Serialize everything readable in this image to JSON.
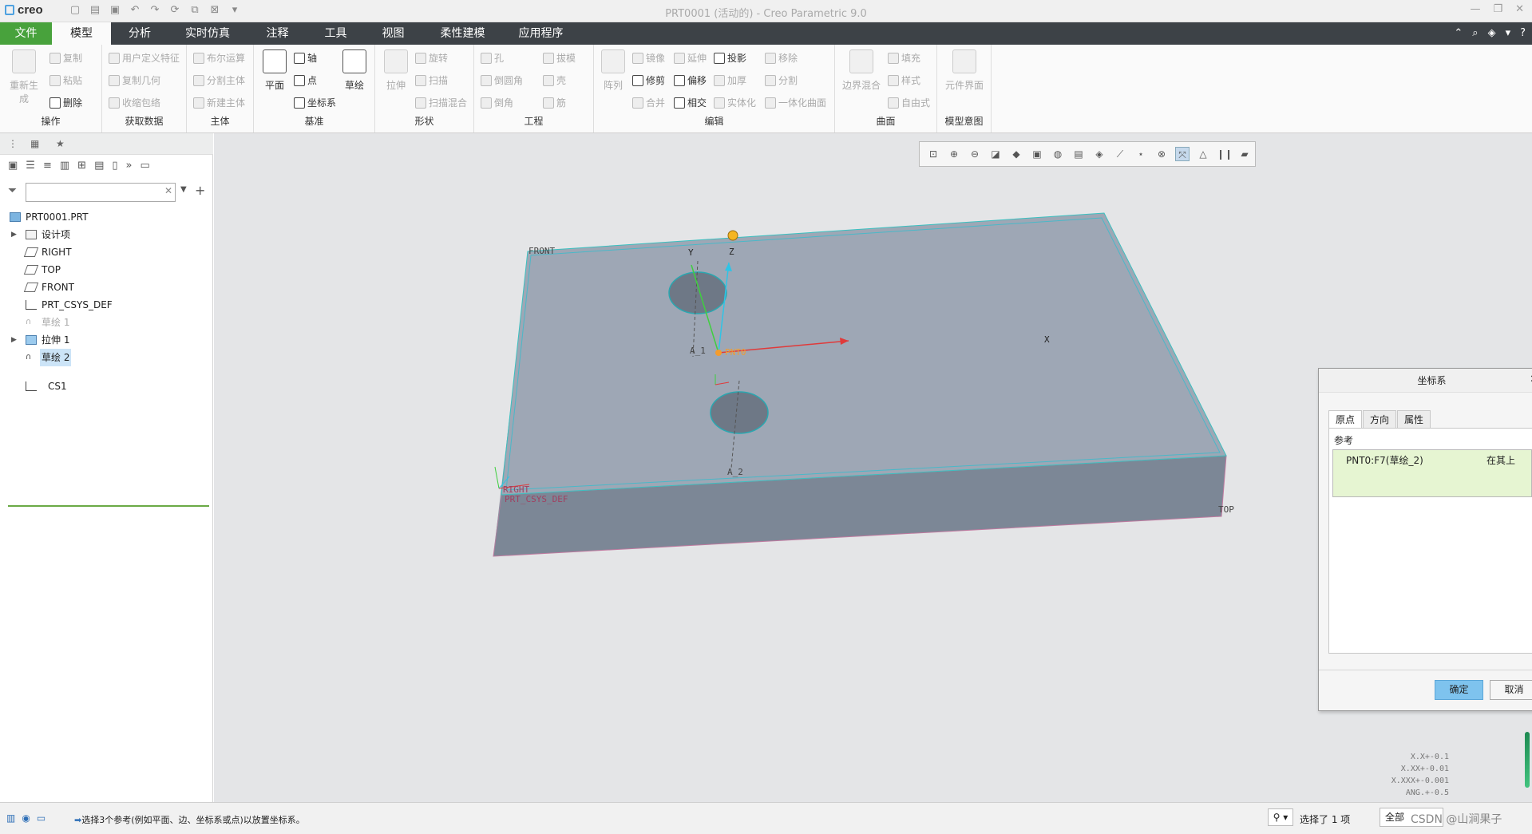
{
  "app": {
    "brand": "creo",
    "window_title": "PRT0001 (活动的) - Creo Parametric 9.0"
  },
  "colors": {
    "file_tab": "#48a23c",
    "menu_bg": "#3d4247",
    "part_face": "#9ea7b5",
    "part_side": "#7f8a98",
    "selection_green": "#e6f5d2",
    "ok_button": "#7ec3ee"
  },
  "menu": {
    "tabs": [
      "文件",
      "模型",
      "分析",
      "实时仿真",
      "注释",
      "工具",
      "视图",
      "柔性建模",
      "应用程序"
    ],
    "active": "模型"
  },
  "ribbon": {
    "groups": {
      "operations": {
        "label": "操作",
        "regenerate": "重新生成",
        "copy": "复制",
        "paste": "粘贴",
        "delete": "删除"
      },
      "get_data": {
        "label": "获取数据",
        "udf": "用户定义特征",
        "copy_geom": "复制几何",
        "shrinkwrap": "收缩包络"
      },
      "body": {
        "label": "主体",
        "boolean": "布尔运算",
        "split_body": "分割主体",
        "new_body": "新建主体"
      },
      "datum": {
        "label": "基准",
        "plane": "平面",
        "axis": "轴",
        "point": "点",
        "csys": "坐标系",
        "sketch": "草绘"
      },
      "shapes": {
        "label": "形状",
        "extrude": "拉伸",
        "revolve": "旋转",
        "sweep": "扫描",
        "swept_blend": "扫描混合"
      },
      "engineering": {
        "label": "工程",
        "hole": "孔",
        "round": "倒圆角",
        "chamfer": "倒角",
        "draft": "拔模",
        "shell": "壳",
        "rib": "筋"
      },
      "editing": {
        "label": "编辑",
        "pattern": "阵列",
        "mirror": "镜像",
        "trim": "修剪",
        "merge": "合并",
        "extend": "延伸",
        "offset": "偏移",
        "intersect": "相交",
        "project": "投影",
        "thicken": "加厚",
        "solidify": "实体化",
        "remove": "移除",
        "split": "分割",
        "unify": "一体化曲面"
      },
      "surfaces": {
        "label": "曲面",
        "boundary_blend": "边界混合",
        "fill": "填充",
        "style": "样式",
        "freestyle": "自由式"
      },
      "model_intent": {
        "label": "模型意图",
        "component_interface": "元件界面"
      }
    }
  },
  "model_tree": {
    "search_placeholder": "",
    "items": [
      {
        "label": "PRT0001.PRT",
        "state": "normal"
      },
      {
        "label": "设计项",
        "state": "normal"
      },
      {
        "label": "RIGHT",
        "state": "normal"
      },
      {
        "label": "TOP",
        "state": "normal"
      },
      {
        "label": "FRONT",
        "state": "normal"
      },
      {
        "label": "PRT_CSYS_DEF",
        "state": "normal"
      },
      {
        "label": "草绘 1",
        "state": "dim"
      },
      {
        "label": "拉伸 1",
        "state": "normal"
      },
      {
        "label": "草绘 2",
        "state": "selected"
      },
      {
        "label": "CS1",
        "state": "normal"
      }
    ]
  },
  "viewport": {
    "labels": {
      "front": "FRONT",
      "right": "RIGHT",
      "top": "TOP",
      "csys_def": "PRT_CSYS_DEF",
      "axis_y": "Y",
      "axis_z": "Z",
      "axis_x": "X",
      "axis_a1": "A_1",
      "axis_a2": "A_2",
      "pnt": "PNT0"
    },
    "tolerances": [
      "X.X+-0.1",
      "X.XX+-0.01",
      "X.XXX+-0.001",
      "ANG.+-0.5"
    ]
  },
  "dialog": {
    "title": "坐标系",
    "tabs": [
      "原点",
      "方向",
      "属性"
    ],
    "active_tab": "原点",
    "ref_label": "参考",
    "reference": {
      "name": "PNT0:F7(草绘_2)",
      "constraint": "在其上"
    },
    "ok": "确定",
    "cancel": "取消"
  },
  "status": {
    "message": "选择3个参考(例如平面、边、坐标系或点)以放置坐标系。",
    "selected": "选择了 1 项",
    "filter": "全部",
    "watermark": "CSDN @山涧果子"
  }
}
